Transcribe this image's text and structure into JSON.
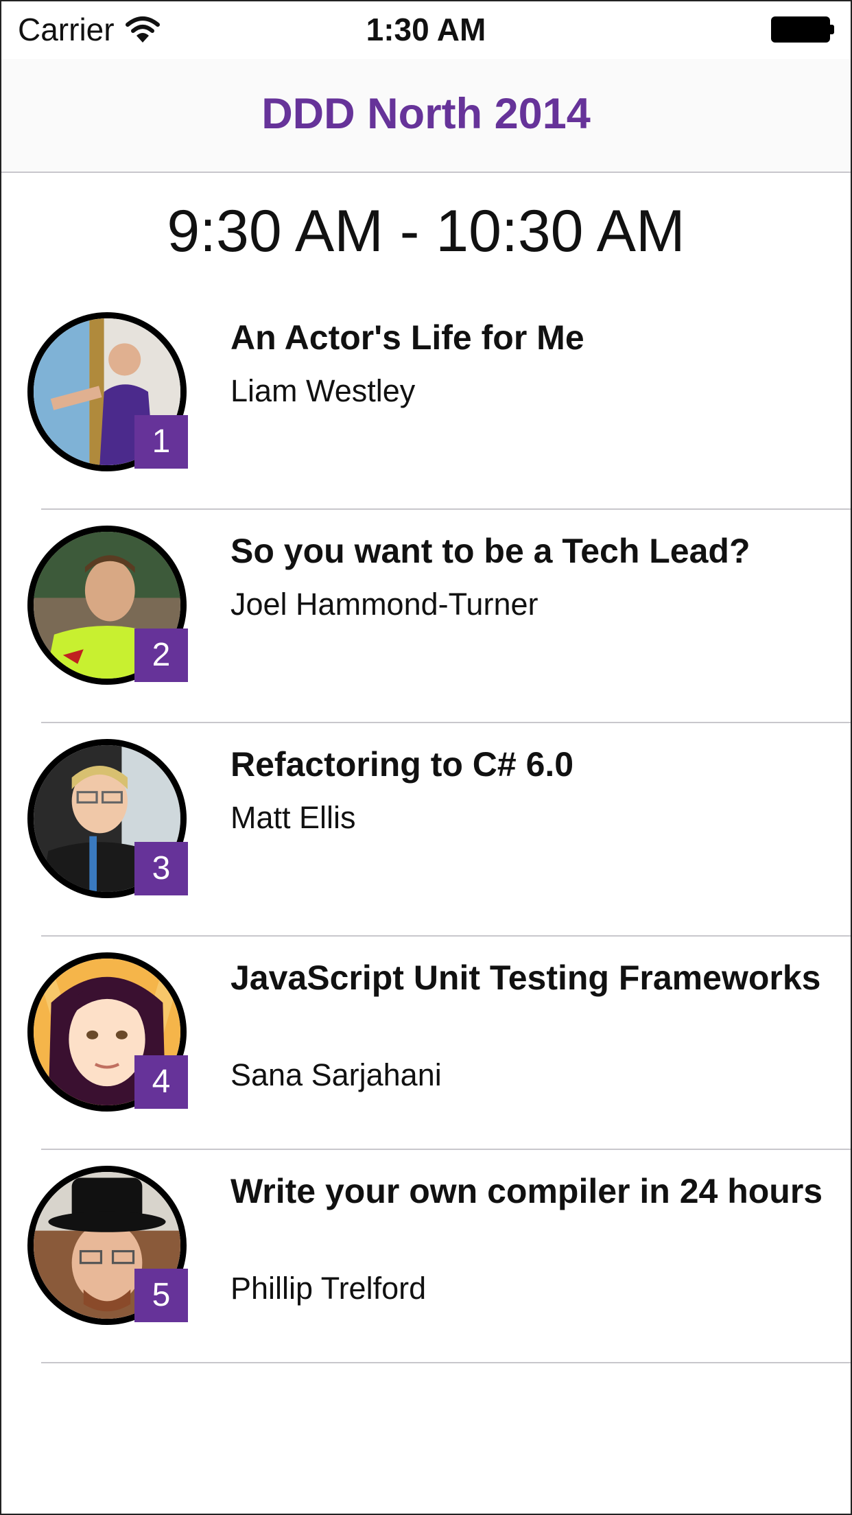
{
  "status_bar": {
    "carrier": "Carrier",
    "time": "1:30 AM",
    "wifi_icon": "wifi-icon",
    "battery_icon": "battery-icon"
  },
  "nav": {
    "title": "DDD North 2014",
    "title_color": "#663399"
  },
  "slot": {
    "time_range": "9:30 AM - 10:30 AM"
  },
  "sessions": [
    {
      "badge": "1",
      "title": "An Actor's Life for Me",
      "speaker": "Liam Westley"
    },
    {
      "badge": "2",
      "title": "So you want to be a Tech Lead?",
      "speaker": "Joel Hammond-Turner"
    },
    {
      "badge": "3",
      "title": "Refactoring to C# 6.0",
      "speaker": "Matt Ellis"
    },
    {
      "badge": "4",
      "title": "JavaScript Unit Testing Frameworks",
      "speaker": "Sana Sarjahani"
    },
    {
      "badge": "5",
      "title": "Write your own compiler in 24 hours",
      "speaker": "Phillip Trelford"
    }
  ],
  "colors": {
    "accent": "#663399",
    "divider": "#c8c7cc"
  }
}
